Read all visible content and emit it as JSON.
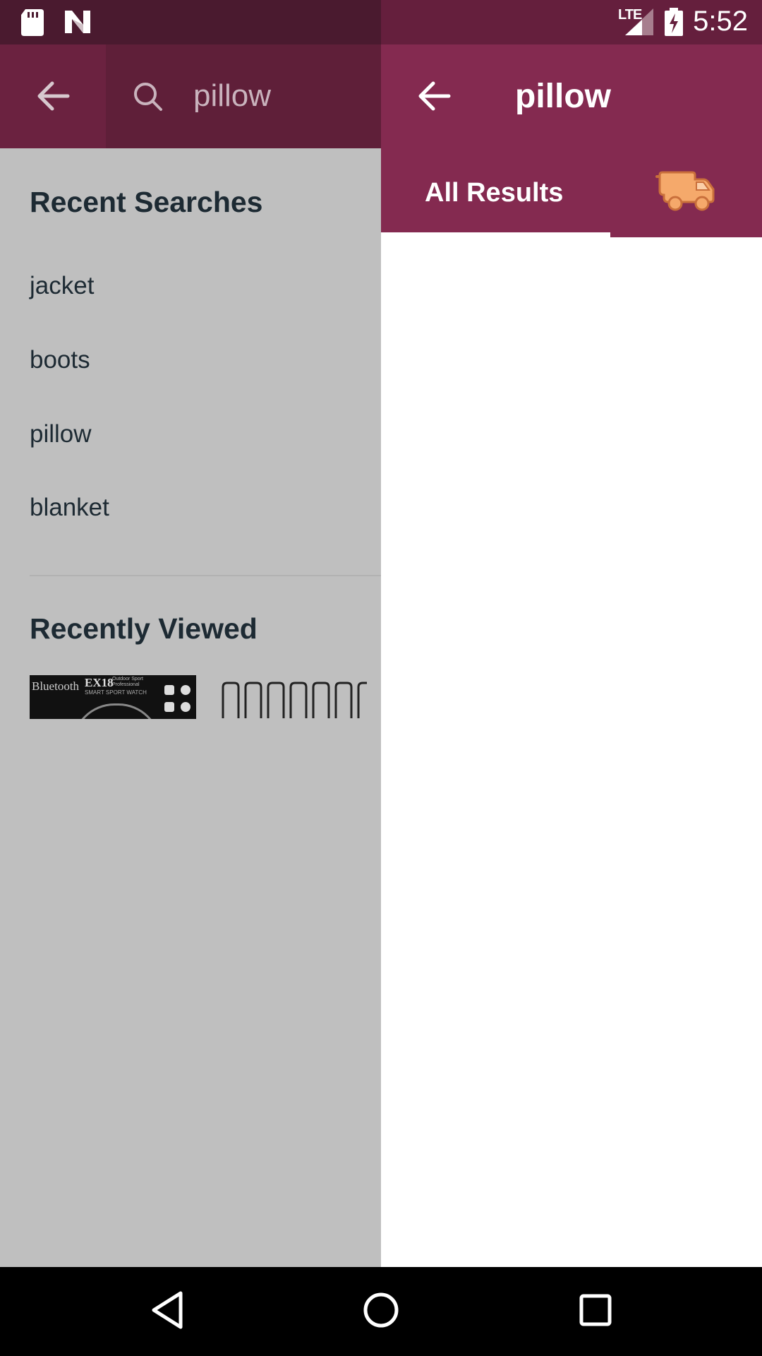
{
  "status_bar": {
    "network": "LTE",
    "time": "5:52",
    "icons": [
      "sd-card-icon",
      "n-icon",
      "signal-icon",
      "battery-charging-icon"
    ]
  },
  "search_panel": {
    "query": "pillow",
    "recent_searches_title": "Recent Searches",
    "recent_searches": [
      "jacket",
      "boots",
      "pillow",
      "blanket"
    ],
    "recently_viewed_title": "Recently Viewed",
    "recently_viewed": [
      {
        "brand": "Bluetooth",
        "model": "EX18",
        "tagline": "Outdoor Sport Professional",
        "subtitle": "SMART SPORT WATCH"
      },
      {
        "name": "clips"
      }
    ]
  },
  "results_panel": {
    "title": "pillow",
    "tabs": [
      {
        "label": "All Results",
        "selected": true
      },
      {
        "icon": "fast-delivery-truck-icon",
        "selected": false
      }
    ]
  },
  "colors": {
    "app_bar": "#842a50",
    "search_bar": "#5f1f39",
    "drawer_scrim": "#bfbfbf",
    "truck": "#f5a96b"
  },
  "nav_bar": {
    "buttons": [
      "back-icon",
      "home-icon",
      "recents-icon"
    ]
  }
}
